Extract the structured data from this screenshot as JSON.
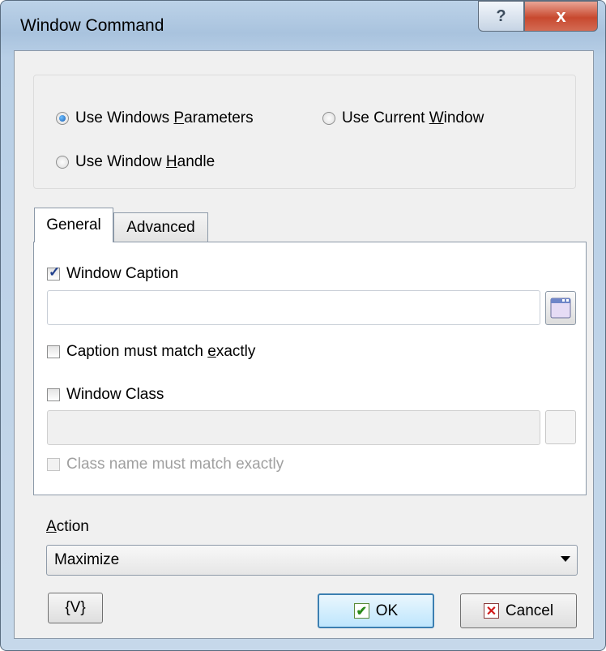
{
  "window": {
    "title": "Window Command",
    "help_glyph": "?",
    "close_glyph": "x"
  },
  "mode": {
    "options": [
      {
        "pre": "Use Windows ",
        "accel": "P",
        "post": "arameters",
        "selected": true
      },
      {
        "pre": "Use Current ",
        "accel": "W",
        "post": "indow",
        "selected": false
      },
      {
        "pre": "Use Window ",
        "accel": "H",
        "post": "andle",
        "selected": false
      }
    ]
  },
  "tabs": [
    {
      "label": "General",
      "active": true
    },
    {
      "label": "Advanced",
      "active": false
    }
  ],
  "general": {
    "window_caption": {
      "label": "Window Caption",
      "checked": true,
      "value": ""
    },
    "caption_exact": {
      "pre": "Caption must match ",
      "accel": "e",
      "post": "xactly",
      "checked": false
    },
    "window_class": {
      "label": "Window Class",
      "checked": false,
      "value": ""
    },
    "class_exact": {
      "label": "Class name must match exactly",
      "checked": false,
      "enabled": false
    }
  },
  "action": {
    "label_accel": "A",
    "label_rest": "ction",
    "selected": "Maximize"
  },
  "buttons": {
    "variables": "{V}",
    "ok": "OK",
    "cancel": "Cancel"
  },
  "colors": {
    "accent": "#3c7fb1",
    "close": "#c8492f"
  }
}
